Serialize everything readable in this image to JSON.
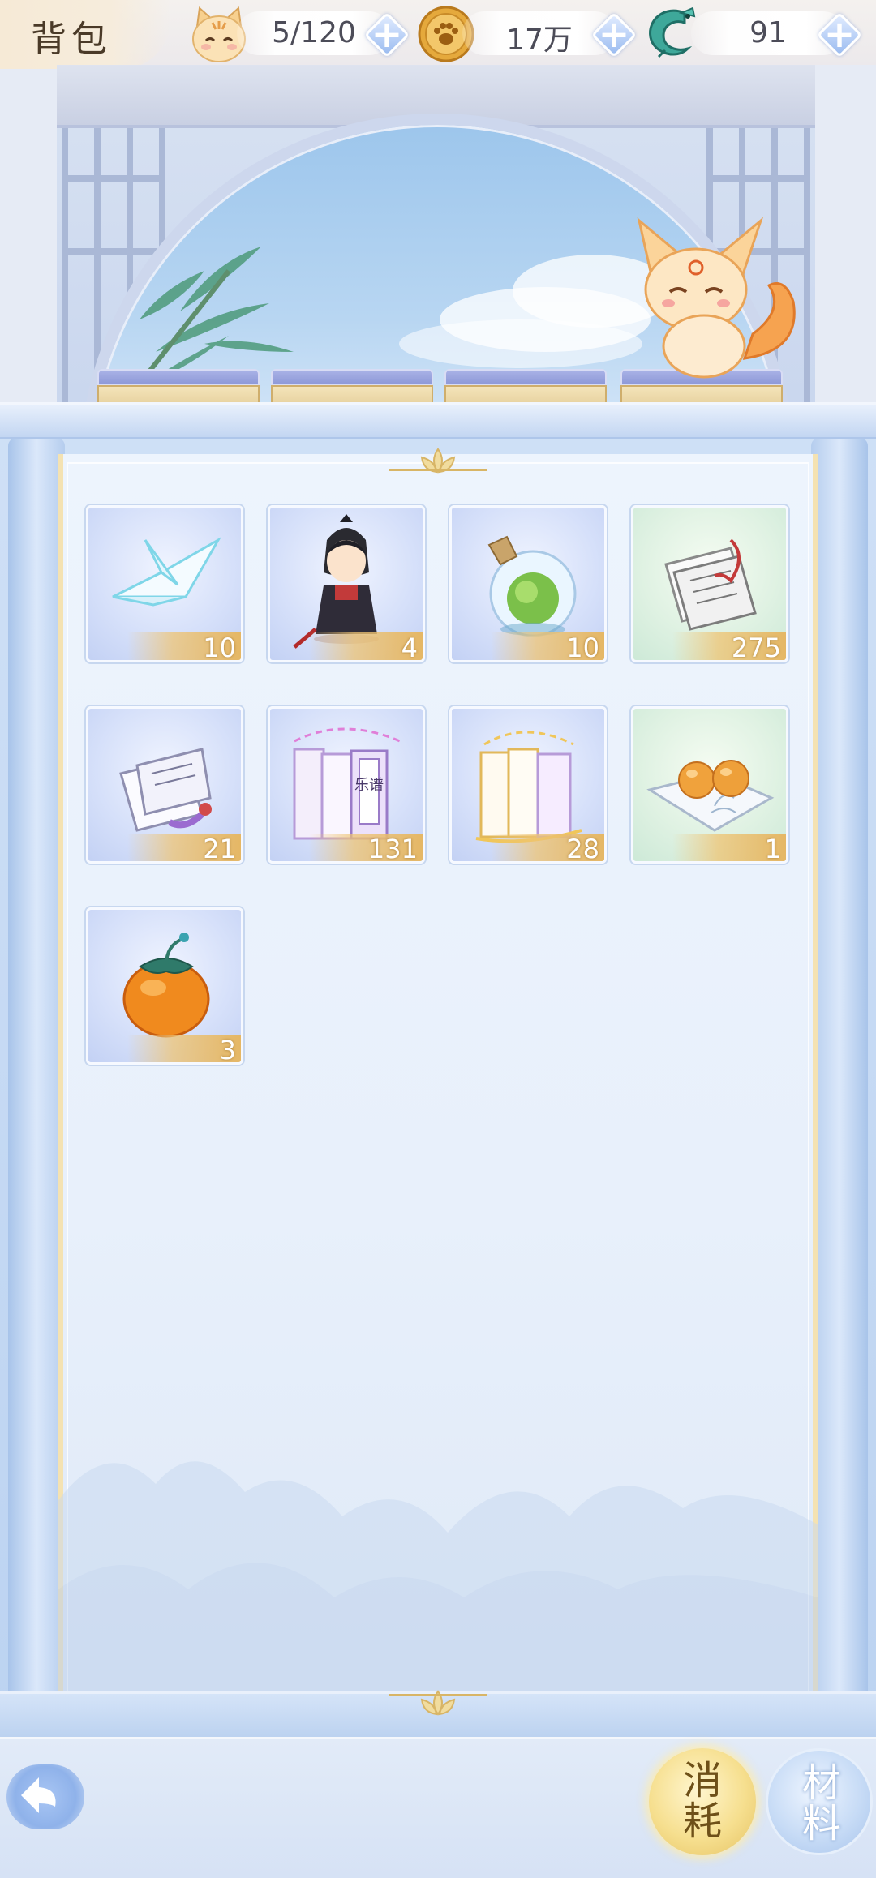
{
  "header": {
    "title": "背包",
    "resources": [
      {
        "name": "cat-stamina",
        "value": "5/120",
        "icon": "cat-face-icon"
      },
      {
        "name": "coin",
        "value": "17万",
        "icon": "paw-coin-icon"
      },
      {
        "name": "jade",
        "value": "91",
        "icon": "jade-dragon-icon"
      }
    ],
    "add_label": "+"
  },
  "inventory": {
    "items": [
      {
        "icon": "paper-crane-icon",
        "quantity": "10",
        "rarity": "blue"
      },
      {
        "icon": "chibi-swordsman-icon",
        "quantity": "4",
        "rarity": "blue"
      },
      {
        "icon": "green-potion-bottle-icon",
        "quantity": "10",
        "rarity": "blue"
      },
      {
        "icon": "scroll-manual-icon",
        "quantity": "275",
        "rarity": "green"
      },
      {
        "icon": "purple-manual-icon",
        "quantity": "21",
        "rarity": "blue"
      },
      {
        "icon": "music-score-books-icon",
        "quantity": "131",
        "rarity": "blue",
        "label": "乐谱"
      },
      {
        "icon": "golden-score-books-icon",
        "quantity": "28",
        "rarity": "blue"
      },
      {
        "icon": "orange-pastries-icon",
        "quantity": "1",
        "rarity": "green"
      },
      {
        "icon": "persimmon-fruit-icon",
        "quantity": "3",
        "rarity": "blue"
      }
    ]
  },
  "footer": {
    "back_icon": "back-arrow-icon",
    "tabs": [
      {
        "top": "消",
        "bottom": "耗",
        "active": true
      },
      {
        "top": "材",
        "bottom": "料",
        "active": false
      }
    ]
  },
  "colors": {
    "frame_blue": "#bcd3f1",
    "gold_accent": "#e5b765",
    "active_tab": "#f6df8f"
  }
}
